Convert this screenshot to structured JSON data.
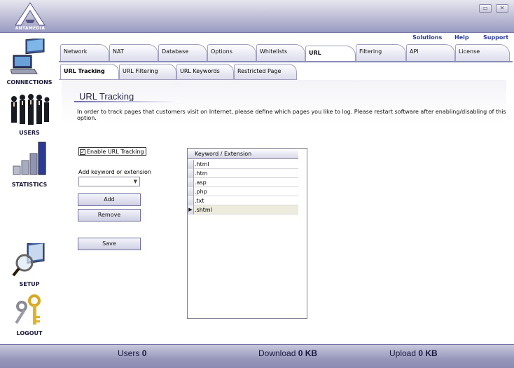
{
  "app": {
    "brand": "ANTAMEDIA"
  },
  "window": {
    "minimize_label": "▭",
    "close_label": "✕"
  },
  "toplinks": {
    "solutions": "Solutions",
    "help": "Help",
    "support": "Support"
  },
  "sidebar": {
    "items": [
      {
        "label": "CONNECTIONS",
        "icon": "computer-icon"
      },
      {
        "label": "USERS",
        "icon": "users-icon"
      },
      {
        "label": "STATISTICS",
        "icon": "bar-chart-icon"
      },
      {
        "label": "SETUP",
        "icon": "magnifier-monitor-icon"
      },
      {
        "label": "LOGOUT",
        "icon": "keys-icon"
      }
    ]
  },
  "tabs": [
    {
      "label": "Network"
    },
    {
      "label": "NAT"
    },
    {
      "label": "Database"
    },
    {
      "label": "Options"
    },
    {
      "label": "Whitelists"
    },
    {
      "label": "URL",
      "active": true
    },
    {
      "label": "Filtering"
    },
    {
      "label": "API"
    },
    {
      "label": "License"
    }
  ],
  "subtabs": [
    {
      "label": "URL Tracking",
      "active": true
    },
    {
      "label": "URL Filtering"
    },
    {
      "label": "URL Keywords"
    },
    {
      "label": "Restricted Page"
    }
  ],
  "content": {
    "title": "URL Tracking",
    "description": "In order to track pages that customers visit on Internet, please define which pages you like to log.  Please restart software after enabling/disabling of this option.",
    "enable_label": "Enable URL Tracking",
    "enable_checked": true,
    "keyword_label": "Add keyword or extension",
    "keyword_value": "",
    "add_button": "Add",
    "remove_button": "Remove",
    "save_button": "Save"
  },
  "grid": {
    "header": "Keyword / Extension",
    "rows": [
      ".html",
      ".htm",
      ".asp",
      ".php",
      ".txt",
      ".shtml"
    ],
    "selected_index": 5
  },
  "status": {
    "users_label": "Users",
    "users_value": "0",
    "download_label": "Download",
    "download_value": "0 KB",
    "upload_label": "Upload",
    "upload_value": "0 KB"
  },
  "colors": {
    "accent": "#9a9ac2",
    "link": "#2a3a9a"
  }
}
